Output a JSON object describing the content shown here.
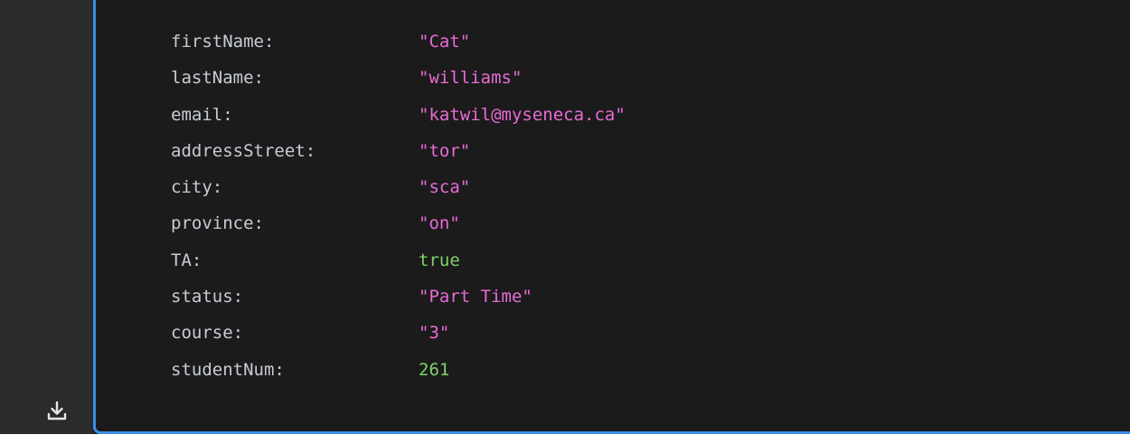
{
  "record": {
    "rows": [
      {
        "key": "firstName:",
        "value": "\"Cat\"",
        "type": "string"
      },
      {
        "key": "lastName:",
        "value": "\"williams\"",
        "type": "string"
      },
      {
        "key": "email:",
        "value": "\"katwil@myseneca.ca\"",
        "type": "string"
      },
      {
        "key": "addressStreet:",
        "value": "\"tor\"",
        "type": "string"
      },
      {
        "key": "city:",
        "value": "\"sca\"",
        "type": "string"
      },
      {
        "key": "province:",
        "value": "\"on\"",
        "type": "string"
      },
      {
        "key": "TA:",
        "value": "true",
        "type": "bool"
      },
      {
        "key": "status:",
        "value": "\"Part Time\"",
        "type": "string"
      },
      {
        "key": "course:",
        "value": "\"3\"",
        "type": "string"
      },
      {
        "key": "studentNum:",
        "value": "261",
        "type": "number"
      }
    ]
  },
  "toolbar": {
    "download_icon": "download-icon"
  },
  "colors": {
    "background": "#1f1f1f",
    "gutter": "#2b2b2b",
    "accent_border": "#3a8ee6",
    "key_text": "#c7ccd6",
    "string_value": "#e86bd6",
    "literal_value": "#7ed36a"
  }
}
